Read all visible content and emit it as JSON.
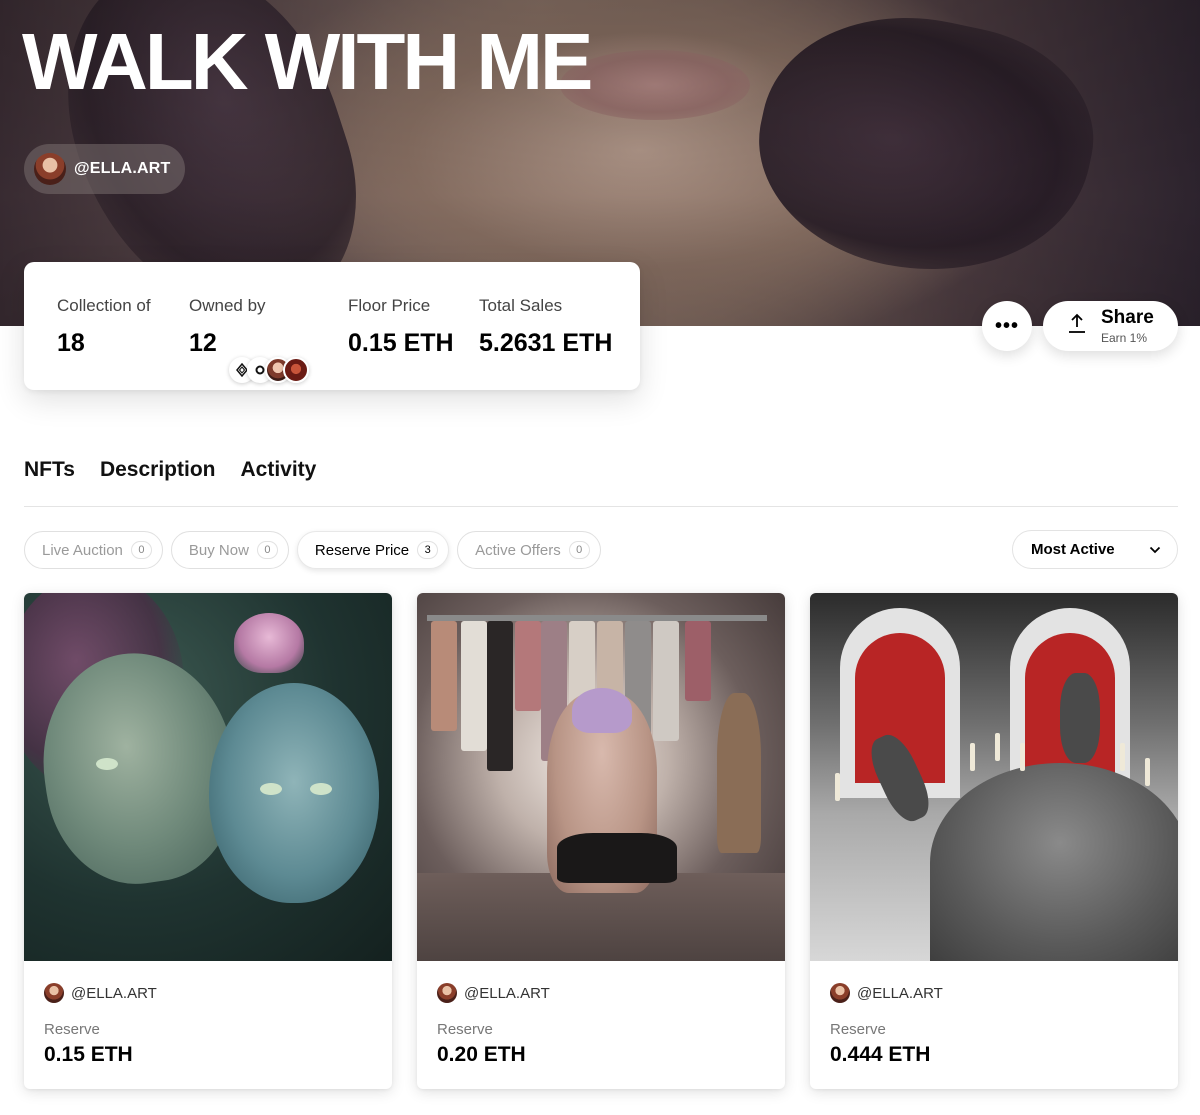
{
  "hero": {
    "title": "WALK WITH ME",
    "artist_handle": "@ELLA.ART"
  },
  "stats": {
    "collection": {
      "label": "Collection of",
      "value": "18"
    },
    "owned": {
      "label": "Owned by",
      "value": "12"
    },
    "floor": {
      "label": "Floor Price",
      "value": "0.15 ETH"
    },
    "sales": {
      "label": "Total Sales",
      "value": "5.2631 ETH"
    }
  },
  "actions": {
    "more_label": "•••",
    "share_label": "Share",
    "share_sub": "Earn 1%"
  },
  "tabs": [
    {
      "label": "NFTs"
    },
    {
      "label": "Description"
    },
    {
      "label": "Activity"
    }
  ],
  "filters": [
    {
      "label": "Live Auction",
      "count": "0"
    },
    {
      "label": "Buy Now",
      "count": "0"
    },
    {
      "label": "Reserve Price",
      "count": "3",
      "active": true
    },
    {
      "label": "Active Offers",
      "count": "0"
    }
  ],
  "sort": {
    "selected": "Most Active"
  },
  "nfts": [
    {
      "creator": "@ELLA.ART",
      "price_label": "Reserve",
      "price": "0.15 ETH"
    },
    {
      "creator": "@ELLA.ART",
      "price_label": "Reserve",
      "price": "0.20 ETH"
    },
    {
      "creator": "@ELLA.ART",
      "price_label": "Reserve",
      "price": "0.444 ETH"
    }
  ],
  "colors": {
    "accent_text": "#000000",
    "muted_text": "#9a9a9a",
    "curtain_red": "#b82525"
  }
}
